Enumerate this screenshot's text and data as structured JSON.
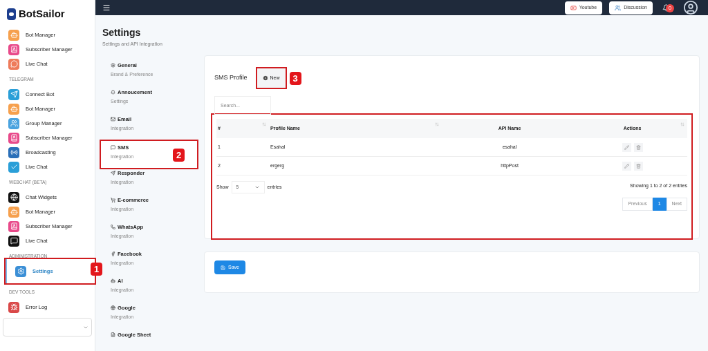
{
  "brand": "BotSailor",
  "sidebar": {
    "sections": [
      {
        "items": [
          {
            "label": "Bot Manager",
            "kind": "bot",
            "selected": false
          },
          {
            "label": "Subscriber Manager",
            "kind": "subscriber",
            "selected": false
          },
          {
            "label": "Live Chat",
            "kind": "chat",
            "selected": false
          }
        ]
      },
      {
        "heading": "TELEGRAM",
        "items": [
          {
            "label": "Connect Bot",
            "kind": "telegram",
            "selected": false
          },
          {
            "label": "Bot Manager",
            "kind": "bot",
            "selected": false
          },
          {
            "label": "Group Manager",
            "kind": "group",
            "selected": false
          },
          {
            "label": "Subscriber Manager",
            "kind": "subscriber",
            "selected": false
          },
          {
            "label": "Broadcasting",
            "kind": "broadcast",
            "selected": false
          },
          {
            "label": "Live Chat",
            "kind": "check",
            "selected": false
          }
        ]
      },
      {
        "heading": "WEBCHAT (BETA)",
        "items": [
          {
            "label": "Chat Widgets",
            "kind": "globe",
            "selected": false
          },
          {
            "label": "Bot Manager",
            "kind": "bot",
            "selected": false
          },
          {
            "label": "Subscriber Manager",
            "kind": "subscriber",
            "selected": false
          },
          {
            "label": "Live Chat",
            "kind": "dots",
            "selected": false
          }
        ]
      },
      {
        "heading": "ADMINISTRATION",
        "items": [
          {
            "label": "Settings",
            "kind": "gear",
            "selected": true,
            "callout": "1"
          }
        ]
      },
      {
        "heading": "DEV TOOLS",
        "items": [
          {
            "label": "Error Log",
            "kind": "bug",
            "selected": false
          }
        ]
      }
    ]
  },
  "topbar": {
    "buttons": [
      {
        "label": "Youtube",
        "kind": "youtube"
      },
      {
        "label": "Discussion",
        "kind": "users"
      }
    ],
    "notification_count": "0"
  },
  "page": {
    "title": "Settings",
    "subtitle": "Settings and API Integration"
  },
  "settings_nav": [
    {
      "title": "General",
      "subtitle": "Brand & Preference",
      "kind": "gear",
      "selected": false
    },
    {
      "title": "Annoucement",
      "subtitle": "Settings",
      "kind": "bell",
      "selected": false
    },
    {
      "title": "Email",
      "subtitle": "Integration",
      "kind": "mail",
      "selected": false
    },
    {
      "title": "SMS",
      "subtitle": "Integration",
      "kind": "sms",
      "selected": true,
      "callout": "2"
    },
    {
      "title": "Responder",
      "subtitle": "Integration",
      "kind": "send",
      "selected": false
    },
    {
      "title": "E-commerce",
      "subtitle": "Integration",
      "kind": "cart",
      "selected": false
    },
    {
      "title": "WhatsApp",
      "subtitle": "Integration",
      "kind": "whatsapp",
      "selected": false
    },
    {
      "title": "Facebook",
      "subtitle": "Integration",
      "kind": "facebook",
      "selected": false
    },
    {
      "title": "AI",
      "subtitle": "Integration",
      "kind": "robot",
      "selected": false
    },
    {
      "title": "Google",
      "subtitle": "Integration",
      "kind": "google",
      "selected": false
    },
    {
      "title": "Google Sheet",
      "kind": "sheet",
      "selected": false
    }
  ],
  "sms_profile": {
    "title": "SMS Profile",
    "new_button": {
      "label": "New",
      "callout": "3"
    },
    "search": {
      "placeholder": "Search..."
    },
    "table": {
      "columns": [
        "#",
        "Profile Name",
        "API Name",
        "Actions"
      ],
      "rows": [
        {
          "cells": [
            "1",
            "Esahal",
            "esahal"
          ]
        },
        {
          "cells": [
            "2",
            "ergerg",
            "httpPost"
          ]
        }
      ]
    },
    "show_label": "Show",
    "page_size": "5",
    "entries_label": "entries",
    "info": "Showing 1 to 2 of 2 entries",
    "pagination": [
      {
        "label": "Previous",
        "selected": false
      },
      {
        "label": "1",
        "selected": true
      },
      {
        "label": "Next",
        "selected": false
      }
    ]
  },
  "save_button": {
    "label": "Save"
  }
}
